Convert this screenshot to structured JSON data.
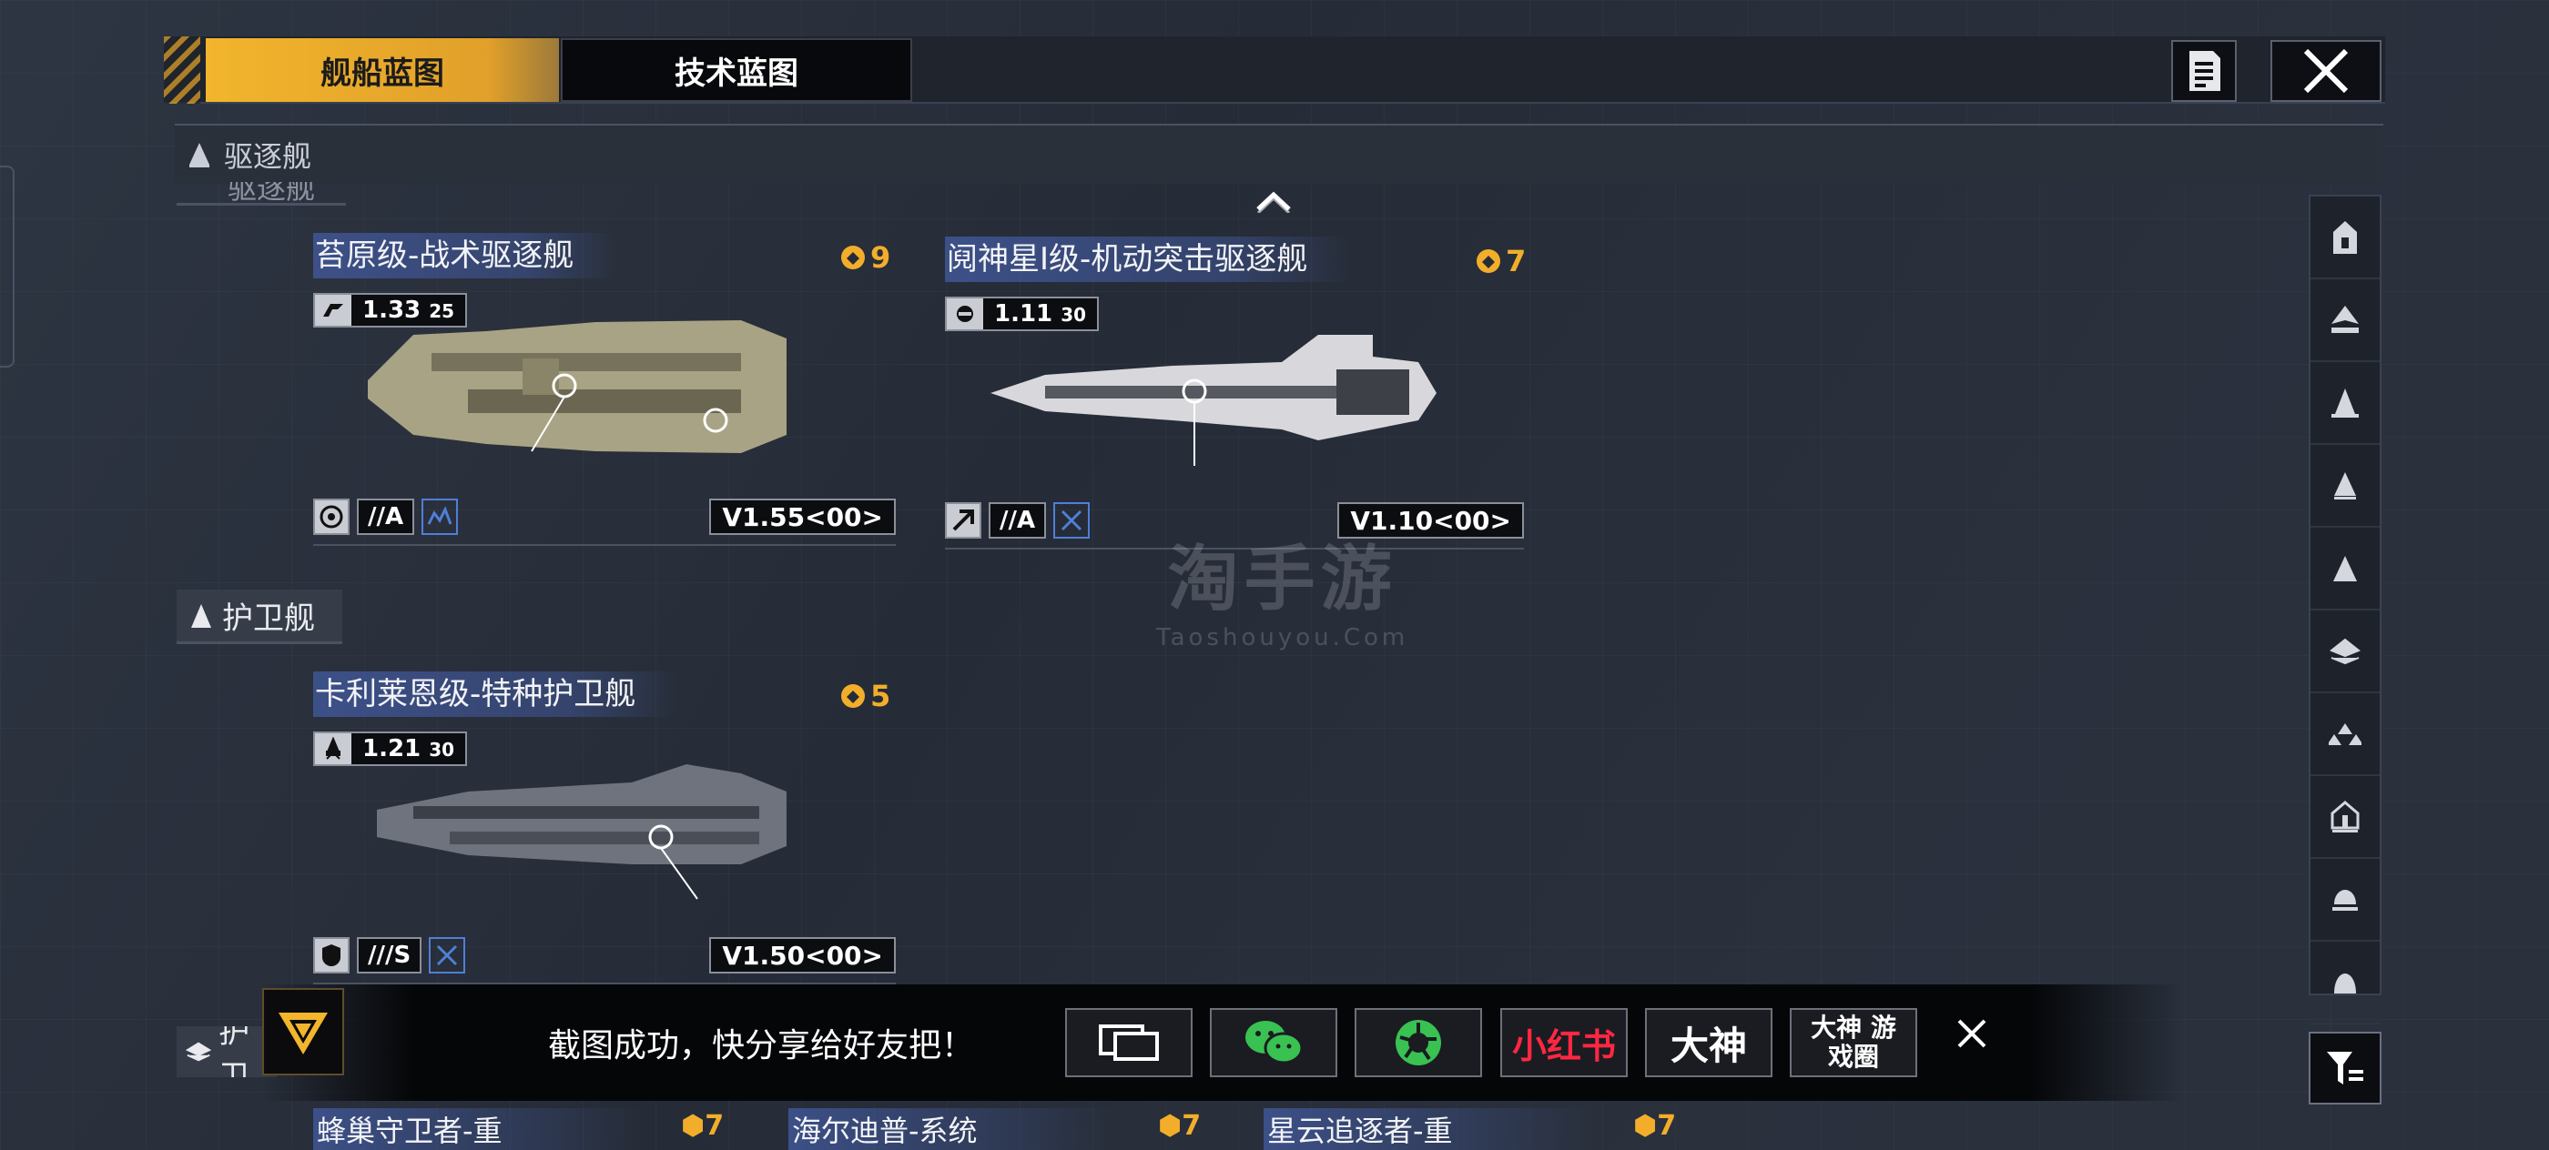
{
  "tabs": {
    "ship_blueprint": "舰船蓝图",
    "tech_blueprint": "技术蓝图"
  },
  "category_header": "驱逐舰",
  "ghost_category": "驱逐舰",
  "section_escort": "护卫舰",
  "cards": [
    {
      "name": "苔原级-战术驱逐舰",
      "cost": "9",
      "stat": "1.33",
      "stat_small": "25",
      "grade": "//A",
      "version": "V1.55<00>"
    },
    {
      "name": "阋神星I级-机动突击驱逐舰",
      "cost": "7",
      "stat": "1.11",
      "stat_small": "30",
      "grade": "//A",
      "version": "V1.10<00>"
    },
    {
      "name": "卡利莱恩级-特种护卫舰",
      "cost": "5",
      "stat": "1.21",
      "stat_small": "30",
      "grade": "///S",
      "version": "V1.50<00>"
    }
  ],
  "peek_cards": [
    {
      "name": "蜂巢守卫者-重",
      "cost": "7"
    },
    {
      "name": "海尔迪普-系统",
      "cost": "7"
    },
    {
      "name": "星云追逐者-重",
      "cost": "7"
    }
  ],
  "hidden_section": "护卫",
  "watermark": {
    "big": "淘手游",
    "small": "Taoshouyou.Com"
  },
  "toast": {
    "message": "截图成功，快分享给好友把！",
    "share_options": [
      "screenshot-frame",
      "wechat",
      "moments",
      "小红书",
      "大神",
      "大神 游戏圈"
    ]
  },
  "colors": {
    "accent": "#f2b52c",
    "cost": "#f2ae2b",
    "name_band": "#405696"
  }
}
